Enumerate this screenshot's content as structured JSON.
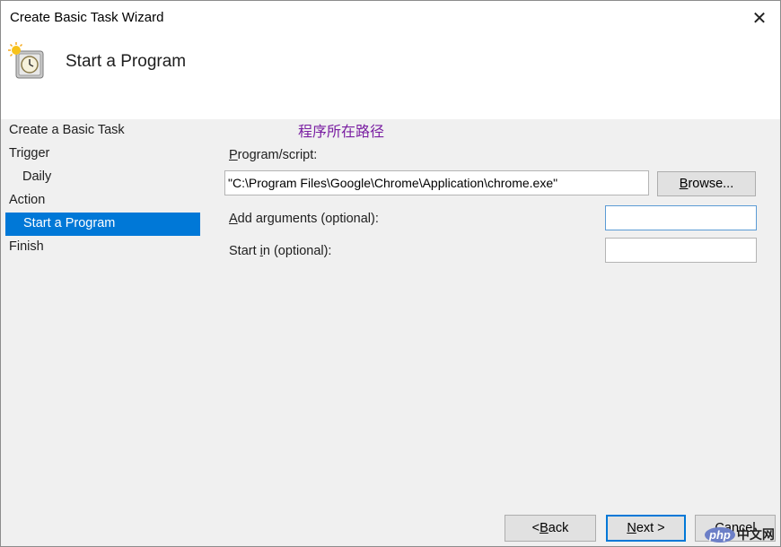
{
  "window": {
    "title": "Create Basic Task Wizard",
    "close_glyph": "✕"
  },
  "header": {
    "title": "Start a Program",
    "icon": "task-clock-icon"
  },
  "steps": [
    {
      "label": "Create a Basic Task",
      "sub": false,
      "active": false
    },
    {
      "label": "Trigger",
      "sub": false,
      "active": false
    },
    {
      "label": "Daily",
      "sub": true,
      "active": false
    },
    {
      "label": "Action",
      "sub": false,
      "active": false
    },
    {
      "label": "Start a Program",
      "sub": true,
      "active": true
    },
    {
      "label": "Finish",
      "sub": false,
      "active": false
    }
  ],
  "annotation": "程序所在路径",
  "form": {
    "program_label_u": "P",
    "program_label_rest": "rogram/script:",
    "program_value": "\"C:\\Program Files\\Google\\Chrome\\Application\\chrome.exe\"",
    "browse_u": "B",
    "browse_rest": "rowse...",
    "args_label_u": "A",
    "args_label_rest": "dd arguments (optional):",
    "args_value": "",
    "startin_label_pre": "Start ",
    "startin_label_u": "i",
    "startin_label_rest": "n (optional):",
    "startin_value": ""
  },
  "buttons": {
    "back_pre": "< ",
    "back_u": "B",
    "back_rest": "ack",
    "next_u": "N",
    "next_rest": "ext >",
    "cancel": "Cancel"
  },
  "watermark": {
    "php": "php",
    "site": "中文网"
  },
  "colors": {
    "accent": "#0078d7",
    "annotation": "#7a1fa2"
  }
}
